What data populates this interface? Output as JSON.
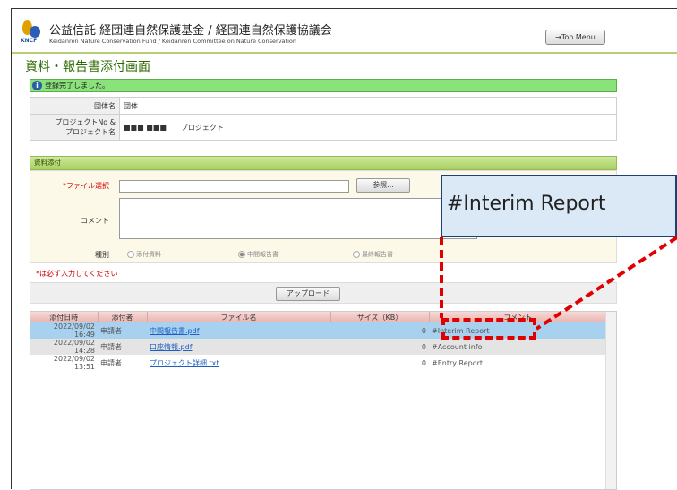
{
  "header": {
    "org_title": "公益信託 経団連自然保護基金 / 経団連自然保護協議会",
    "org_subtitle": "Keidanren Nature Conservation Fund / Keidanren Committee on Nature Conservation",
    "logo_text": "KNCF",
    "top_menu_label": "→Top Menu"
  },
  "page_title": "資料・報告書添付画面",
  "message": {
    "icon": "info-icon",
    "text": "登録完了しました。"
  },
  "info_table": [
    {
      "label": "団体名",
      "value": "団体"
    },
    {
      "label": "プロジェクトNo &\nプロジェクト名",
      "value": "■■■ ■■■　　プロジェクト"
    }
  ],
  "attach_section": {
    "title": "資料添付",
    "file_label": "*ファイル選択",
    "browse_label": "参照...",
    "comment_label": "コメント",
    "type_label": "種別",
    "types": [
      {
        "label": "添付資料",
        "selected": false
      },
      {
        "label": "中間報告書",
        "selected": true
      },
      {
        "label": "最終報告書",
        "selected": false
      }
    ]
  },
  "required_note": "*は必ず入力してください",
  "upload_label": "アップロード",
  "file_list": {
    "columns": [
      "添付日時",
      "添付者",
      "ファイル名",
      "サイズ（KB）",
      "コメント"
    ],
    "rows": [
      {
        "date": "2022/09/02 16:49",
        "by": "申請者",
        "name": "中間報告書.pdf",
        "size": "0",
        "comment": "#Interim Report"
      },
      {
        "date": "2022/09/02 14:28",
        "by": "申請者",
        "name": "口座情報.pdf",
        "size": "0",
        "comment": "#Account info"
      },
      {
        "date": "2022/09/02 13:51",
        "by": "申請者",
        "name": "プロジェクト詳細.txt",
        "size": "0",
        "comment": "#Entry Report"
      }
    ]
  },
  "callout_text": "#Interim Report",
  "colors": {
    "accent_green": "#89e27a",
    "highlight_red": "#e00000",
    "selected_row": "#a8d1ef"
  }
}
